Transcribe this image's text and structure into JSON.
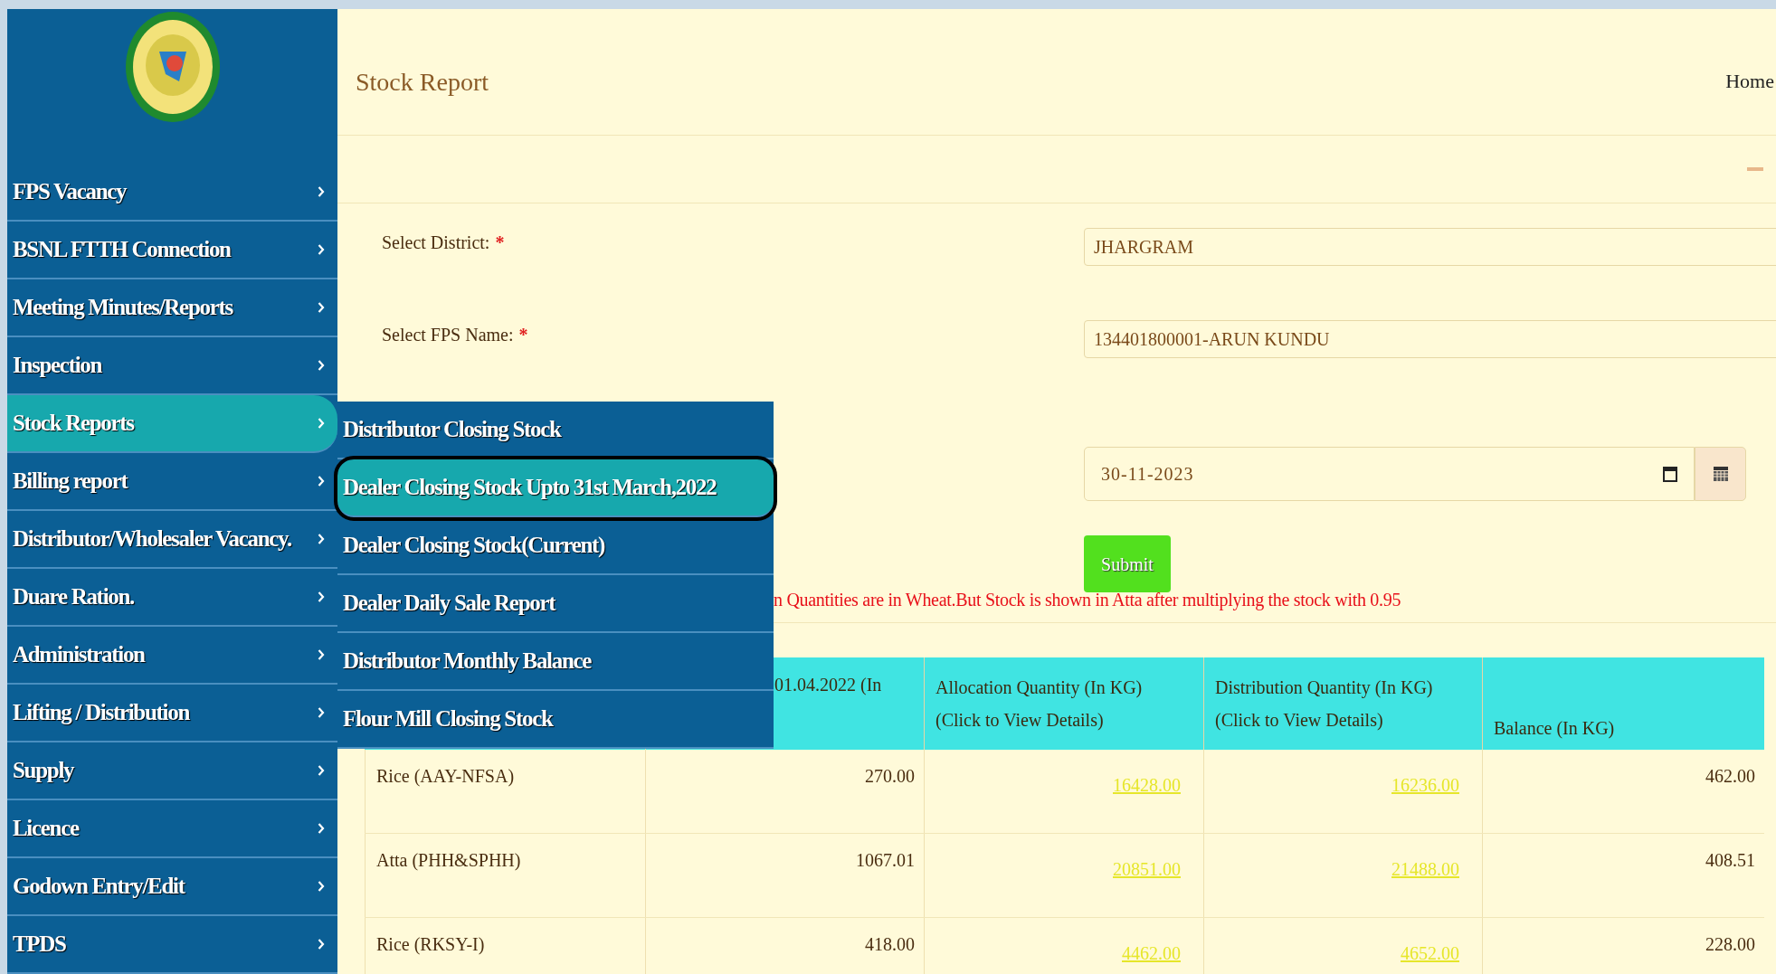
{
  "sidebar": {
    "items": [
      {
        "label": "FPS Vacancy",
        "selected": false
      },
      {
        "label": "BSNL FTTH Connection",
        "selected": false
      },
      {
        "label": "Meeting Minutes/Reports",
        "selected": false
      },
      {
        "label": "Inspection",
        "selected": false
      },
      {
        "label": "Stock Reports",
        "selected": true
      },
      {
        "label": "Billing report",
        "selected": false
      },
      {
        "label": "Distributor/Wholesaler Vacancy.",
        "selected": false
      },
      {
        "label": "Duare Ration.",
        "selected": false
      },
      {
        "label": "Administration",
        "selected": false
      },
      {
        "label": "Lifting / Distribution",
        "selected": false
      },
      {
        "label": "Supply",
        "selected": false
      },
      {
        "label": "Licence",
        "selected": false
      },
      {
        "label": "Godown Entry/Edit",
        "selected": false
      },
      {
        "label": "TPDS",
        "selected": false
      }
    ]
  },
  "submenu": {
    "items": [
      {
        "label": "Distributor Closing Stock",
        "selected": false
      },
      {
        "label": "Dealer Closing Stock Upto 31st March,2022",
        "selected": true
      },
      {
        "label": "Dealer Closing Stock(Current)",
        "selected": false
      },
      {
        "label": "Dealer Daily Sale Report",
        "selected": false
      },
      {
        "label": "Distributor Monthly Balance",
        "selected": false
      },
      {
        "label": "Flour Mill Closing Stock",
        "selected": false
      }
    ]
  },
  "page": {
    "title": "Stock Report",
    "breadcrumb": "Home"
  },
  "form": {
    "fields": [
      {
        "label": "Select District:",
        "required_mark": "*",
        "value": "JHARGRAM"
      },
      {
        "label": "Select FPS Name:",
        "required_mark": "*",
        "value": "134401800001-ARUN KUNDU"
      }
    ],
    "date": {
      "value": "30-11-2023"
    },
    "submit": "Submit",
    "note": "n Quantities are in Wheat.But Stock is shown in Atta after multiplying the stock with 0.95"
  },
  "table": {
    "columns": [
      {
        "lines": [
          "01.04.2022 (In"
        ]
      },
      {
        "lines": [
          "Allocation Quantity (In KG)",
          "(Click to View Details)"
        ]
      },
      {
        "lines": [
          "Distribution Quantity (In KG)",
          "(Click to View Details)"
        ]
      },
      {
        "lines": [
          "Balance (In KG)"
        ]
      }
    ],
    "rows": [
      {
        "item": "Rice (AAY-NFSA)",
        "opening": "270.00",
        "allocation": "16428.00",
        "distribution": "16236.00",
        "balance": "462.00"
      },
      {
        "item": "Atta (PHH&SPHH)",
        "opening": "1067.01",
        "allocation": "20851.00",
        "distribution": "21488.00",
        "balance": "408.51"
      },
      {
        "item": "Rice (RKSY-I)",
        "opening": "418.00",
        "allocation": "4462.00",
        "distribution": "4652.00",
        "balance": "228.00"
      }
    ]
  }
}
